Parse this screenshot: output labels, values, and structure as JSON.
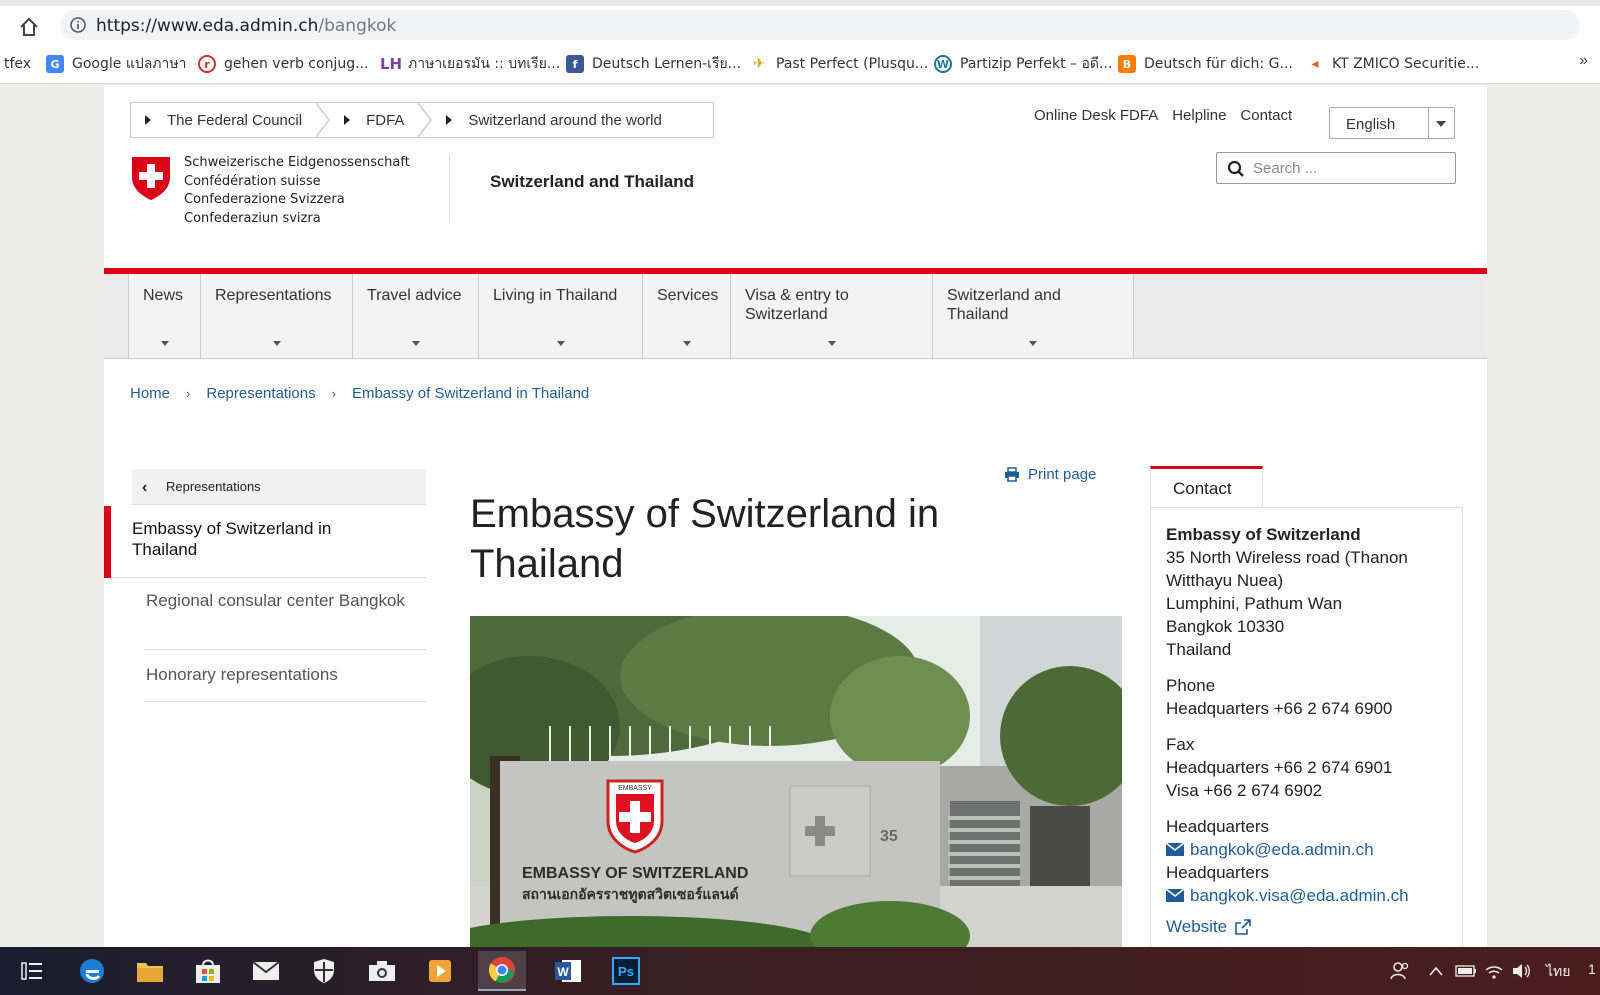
{
  "browser": {
    "url_host": "https://www.eda.admin.ch",
    "url_path": "/bangkok",
    "bookmarks": [
      {
        "label": "tfex",
        "icon": ""
      },
      {
        "label": "Google แปลภาษา",
        "icon": "google-translate-icon"
      },
      {
        "label": "gehen verb conjug...",
        "icon": "reverso-icon"
      },
      {
        "label": "ภาษาเยอรมัน :: บทเรีย...",
        "icon": "lh-icon"
      },
      {
        "label": "Deutsch Lernen-เรีย...",
        "icon": "facebook-icon"
      },
      {
        "label": "Past Perfect (Plusqu...",
        "icon": "bird-icon"
      },
      {
        "label": "Partizip Perfekt – อดี...",
        "icon": "wordpress-icon"
      },
      {
        "label": "Deutsch für dich: G...",
        "icon": "blogger-icon"
      },
      {
        "label": "KT ZMICO Securitie...",
        "icon": "kt-icon"
      }
    ],
    "more": "»"
  },
  "header": {
    "top_crumbs": [
      "The Federal Council",
      "FDFA",
      "Switzerland around the world"
    ],
    "links": [
      "Online Desk FDFA",
      "Helpline",
      "Contact"
    ],
    "language": "English",
    "search_placeholder": "Search ...",
    "confed_lines": [
      "Schweizerische Eidgenossenschaft",
      "Confédération suisse",
      "Confederazione Svizzera",
      "Confederaziun svizra"
    ],
    "site_title": "Switzerland and Thailand"
  },
  "nav": [
    "News",
    "Representations",
    "Travel advice",
    "Living in Thailand",
    "Services",
    "Visa & entry to Switzerland",
    "Switzerland and Thailand"
  ],
  "breadcrumb": [
    "Home",
    "Representations",
    "Embassy of Switzerland in Thailand"
  ],
  "sidebar": {
    "back_label": "Representations",
    "active": "Embassy of Switzerland in Thailand",
    "items": [
      "Regional consular center Bangkok",
      "Honorary representations"
    ]
  },
  "main": {
    "print_label": "Print page",
    "title": "Embassy of Switzerland in Thailand",
    "photo_sign_line1": "EMBASSY OF SWITZERLAND",
    "photo_sign_line2": "สถานเอกอัครราชทูตสวิตเซอร์แลนด์",
    "photo_number": "35",
    "photo_crest_text": "EMBASSY"
  },
  "contact": {
    "tab": "Contact",
    "name": "Embassy of Switzerland",
    "address": [
      "35 North Wireless road (Thanon Witthayu Nuea)",
      "Lumphini, Pathum Wan",
      "Bangkok 10330",
      "Thailand"
    ],
    "phone_label": "Phone",
    "phone": "Headquarters +66 2 674 6900",
    "fax_label": "Fax",
    "fax_hq": "Headquarters +66 2 674 6901",
    "fax_visa": "Visa +66 2 674 6902",
    "email1_label": "Headquarters",
    "email1": "bangkok@eda.admin.ch",
    "email2_label": "Headquarters",
    "email2": "bangkok.visa@eda.admin.ch",
    "website": "Website"
  },
  "taskbar": {
    "tray_ime": "ไทย",
    "tray_clock": "1"
  },
  "colors": {
    "accent_red": "#dc0018",
    "link_blue": "#1f5d9a"
  }
}
